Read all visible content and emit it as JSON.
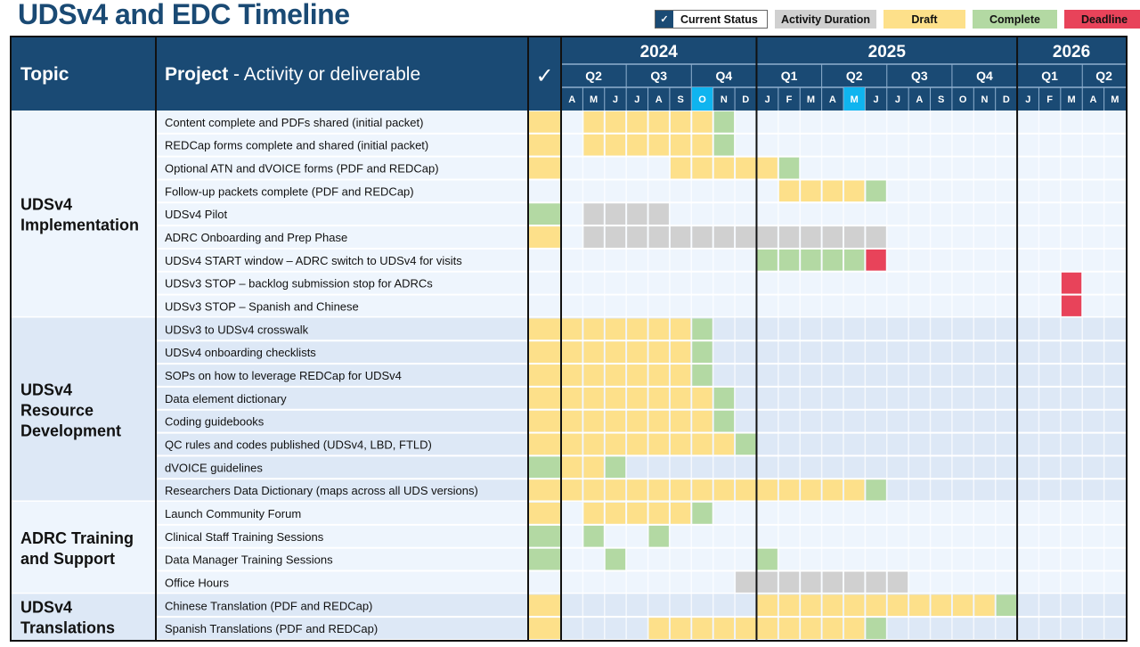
{
  "title": "UDSv4 and EDC Timeline",
  "legend": {
    "current_status": "Current Status",
    "current_status_icon": "✓",
    "activity_duration": "Activity Duration",
    "draft": "Draft",
    "complete": "Complete",
    "deadline": "Deadline"
  },
  "colors": {
    "header": "#1a4a74",
    "highlight_month": "#0fb4ef",
    "draft": "#fde08a",
    "complete": "#b3d9a3",
    "deadline": "#e8435a",
    "duration": "#d0d0d0",
    "row_light": "#eef5fd",
    "row_dark": "#dde8f6"
  },
  "header": {
    "topic": "Topic",
    "project_bold": "Project",
    "project_rest": " - Activity or deliverable",
    "status": "✓"
  },
  "chart_data": {
    "type": "table",
    "title": "UDSv4 and EDC Timeline",
    "years": [
      {
        "label": "2024",
        "months": 9
      },
      {
        "label": "2025",
        "months": 12
      },
      {
        "label": "2026",
        "months": 5
      }
    ],
    "quarters": [
      {
        "label": "Q2",
        "months": 3
      },
      {
        "label": "Q3",
        "months": 3
      },
      {
        "label": "Q4",
        "months": 3
      },
      {
        "label": "Q1",
        "months": 3
      },
      {
        "label": "Q2",
        "months": 3
      },
      {
        "label": "Q3",
        "months": 3
      },
      {
        "label": "Q4",
        "months": 3
      },
      {
        "label": "Q1",
        "months": 3
      },
      {
        "label": "Q2",
        "months": 2
      }
    ],
    "months": [
      "A",
      "M",
      "J",
      "J",
      "A",
      "S",
      "O",
      "N",
      "D",
      "J",
      "F",
      "M",
      "A",
      "M",
      "J",
      "J",
      "A",
      "S",
      "O",
      "N",
      "D",
      "J",
      "F",
      "M",
      "A",
      "M"
    ],
    "highlighted_months": [
      6,
      13
    ],
    "topics": [
      {
        "label": "UDSv4 Implementation",
        "shade": "light",
        "rows": [
          {
            "label": "Content complete and PDFs shared (initial packet)",
            "status": "draft",
            "cells": {
              "draft": [
                1,
                2,
                3,
                4,
                5,
                6
              ],
              "complete": [
                7
              ]
            }
          },
          {
            "label": "REDCap forms complete and shared (initial packet)",
            "status": "draft",
            "cells": {
              "draft": [
                1,
                2,
                3,
                4,
                5,
                6
              ],
              "complete": [
                7
              ]
            }
          },
          {
            "label": "Optional ATN and dVOICE forms (PDF and REDCap)",
            "status": "draft",
            "cells": {
              "draft": [
                5,
                6,
                7,
                8,
                9
              ],
              "complete": [
                10
              ]
            }
          },
          {
            "label": "Follow-up packets complete (PDF and REDCap)",
            "status": "",
            "cells": {
              "draft": [
                10,
                11,
                12,
                13
              ],
              "complete": [
                14
              ]
            }
          },
          {
            "label": "UDSv4 Pilot",
            "status": "complete",
            "cells": {
              "duration": [
                1,
                2,
                3,
                4
              ]
            }
          },
          {
            "label": "ADRC Onboarding and Prep Phase",
            "status": "draft",
            "cells": {
              "duration": [
                1,
                2,
                3,
                4,
                5,
                6,
                7,
                8,
                9,
                10,
                11,
                12,
                13,
                14
              ]
            }
          },
          {
            "label": "UDSv4 START  window – ADRC switch to UDSv4 for visits",
            "status": "",
            "cells": {
              "complete": [
                9,
                10,
                11,
                12,
                13
              ],
              "deadline": [
                14
              ]
            }
          },
          {
            "label": "UDSv3 STOP – backlog submission stop for ADRCs",
            "status": "",
            "cells": {
              "deadline": [
                23
              ]
            }
          },
          {
            "label": "UDSv3 STOP – Spanish and Chinese",
            "status": "",
            "cells": {
              "deadline": [
                23
              ]
            }
          }
        ]
      },
      {
        "label": "UDSv4 Resource Development",
        "shade": "dark",
        "rows": [
          {
            "label": "UDSv3 to UDSv4 crosswalk",
            "status": "draft",
            "cells": {
              "draft": [
                0,
                1,
                2,
                3,
                4,
                5
              ],
              "complete": [
                6
              ]
            }
          },
          {
            "label": "UDSv4 onboarding checklists",
            "status": "draft",
            "cells": {
              "draft": [
                0,
                1,
                2,
                3,
                4,
                5
              ],
              "complete": [
                6
              ]
            }
          },
          {
            "label": "SOPs on how to leverage REDCap for UDSv4",
            "status": "draft",
            "cells": {
              "draft": [
                0,
                1,
                2,
                3,
                4,
                5
              ],
              "complete": [
                6
              ]
            }
          },
          {
            "label": "Data element dictionary",
            "status": "draft",
            "cells": {
              "draft": [
                0,
                1,
                2,
                3,
                4,
                5,
                6
              ],
              "complete": [
                7
              ]
            }
          },
          {
            "label": "Coding guidebooks",
            "status": "draft",
            "cells": {
              "draft": [
                0,
                1,
                2,
                3,
                4,
                5,
                6
              ],
              "complete": [
                7
              ]
            }
          },
          {
            "label": "QC rules and codes published (UDSv4, LBD, FTLD)",
            "status": "draft",
            "cells": {
              "draft": [
                0,
                1,
                2,
                3,
                4,
                5,
                6,
                7
              ],
              "complete": [
                8
              ]
            }
          },
          {
            "label": "dVOICE guidelines",
            "status": "complete",
            "cells": {
              "draft": [
                0,
                1
              ],
              "complete": [
                2
              ]
            }
          },
          {
            "label": "Researchers Data Dictionary (maps across all UDS versions)",
            "status": "draft",
            "cells": {
              "draft": [
                0,
                1,
                2,
                3,
                4,
                5,
                6,
                7,
                8,
                9,
                10,
                11,
                12,
                13
              ],
              "complete": [
                14
              ]
            }
          }
        ]
      },
      {
        "label": "ADRC Training and Support",
        "shade": "light",
        "rows": [
          {
            "label": "Launch Community Forum",
            "status": "draft",
            "cells": {
              "draft": [
                1,
                2,
                3,
                4,
                5
              ],
              "complete": [
                6
              ]
            }
          },
          {
            "label": "Clinical Staff Training Sessions",
            "status": "complete",
            "cells": {
              "complete": [
                1,
                4
              ]
            }
          },
          {
            "label": "Data Manager Training Sessions",
            "status": "complete",
            "cells": {
              "complete": [
                2,
                9
              ]
            }
          },
          {
            "label": "Office Hours",
            "status": "",
            "cells": {
              "duration": [
                8,
                9,
                10,
                11,
                12,
                13,
                14,
                15
              ]
            }
          }
        ]
      },
      {
        "label": "UDSv4 Translations",
        "shade": "dark",
        "rows": [
          {
            "label": "Chinese Translation (PDF and REDCap)",
            "status": "draft",
            "cells": {
              "draft": [
                9,
                10,
                11,
                12,
                13,
                14,
                15,
                16,
                17,
                18,
                19
              ],
              "complete": [
                20
              ]
            }
          },
          {
            "label": "Spanish Translations (PDF and REDCap)",
            "status": "draft",
            "cells": {
              "draft": [
                4,
                5,
                6,
                7,
                8,
                9,
                10,
                11,
                12,
                13
              ],
              "complete": [
                14
              ]
            }
          }
        ]
      }
    ]
  }
}
